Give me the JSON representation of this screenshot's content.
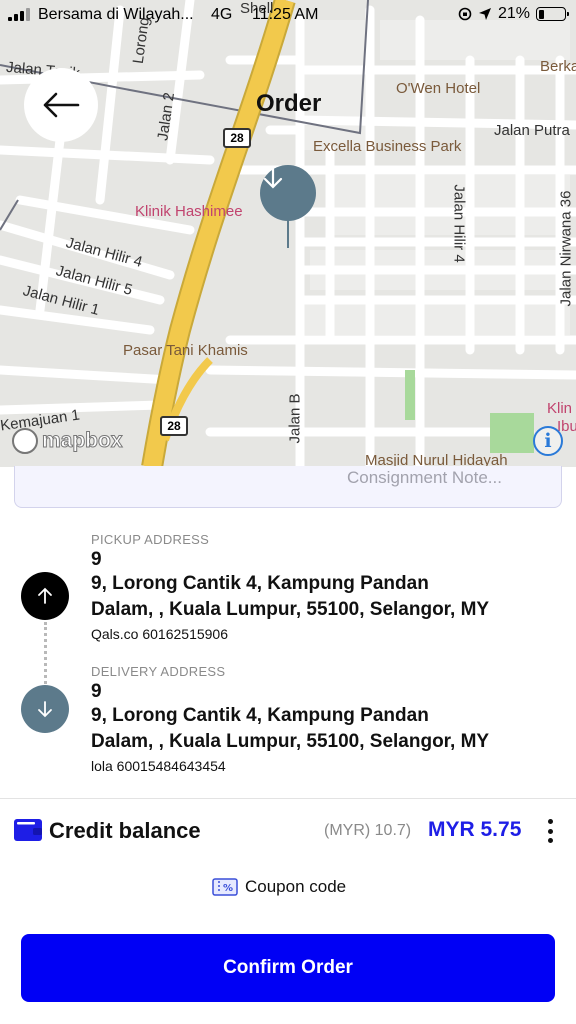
{
  "status_bar": {
    "carrier": "Bersama di Wilayah...",
    "network": "4G",
    "time": "11:25 AM",
    "battery": "21%",
    "battery_level": 0.21
  },
  "map": {
    "labels": {
      "jalan_tasik": "Jalan Tasik",
      "lorong": "Lorong",
      "shell": "Shell",
      "jalan_2": "Jalan 2",
      "oweb_hotel": "O'Wen Hotel",
      "berka": "Berka",
      "jalan_putra": "Jalan Putra",
      "excella": "Excella Business Park",
      "klinik": "Klinik Hashimee",
      "jalan_hilir_4_v": "Jalan Hilir 4",
      "jalan_nirwana": "Jalan Nirwana 36",
      "jalan_hilir_4": "Jalan Hilir 4",
      "jalan_hilir_5": "Jalan Hilir 5",
      "jalan_hilir_1": "Jalan Hilir 1",
      "pasar": "Pasar Tani Khamis",
      "jalan_b": "Jalan B",
      "kemajuan": "Kemajuan 1",
      "masjid": "Masjid Nurul Hidayah",
      "klin": "Klin",
      "ibu": "Ibu",
      "route_28_top": "28",
      "route_28_bottom": "28",
      "mapbox": "mapbox"
    }
  },
  "header": {
    "title": "Order"
  },
  "consignment": {
    "placeholder": "Consignment Note..."
  },
  "pickup": {
    "caption": "PICKUP ADDRESS",
    "unit": "9",
    "line1": "9, Lorong Cantik 4, Kampung Pandan",
    "line2": "Dalam, , Kuala Lumpur, 55100, Selangor, MY",
    "contact": "Qals.co  60162515906"
  },
  "delivery": {
    "caption": "DELIVERY ADDRESS",
    "unit": "9",
    "line1": "9, Lorong Cantik 4, Kampung Pandan",
    "line2": "Dalam, , Kuala Lumpur, 55100, Selangor, MY",
    "contact": "lola  60015484643454"
  },
  "payment": {
    "method": "Credit balance",
    "balance": "(MYR) 10.7)",
    "price": "MYR 5.75",
    "accent_color": "#1e1ee6"
  },
  "coupon": {
    "label": "Coupon code"
  },
  "actions": {
    "confirm_label": "Confirm Order",
    "confirm_color": "#0000f5"
  },
  "icons": {
    "back": "arrow-left-icon",
    "pickup": "arrow-up-icon",
    "delivery": "arrow-down-icon",
    "wallet": "wallet-icon",
    "coupon": "coupon-icon",
    "more": "more-vertical-icon",
    "info": "info-icon"
  }
}
